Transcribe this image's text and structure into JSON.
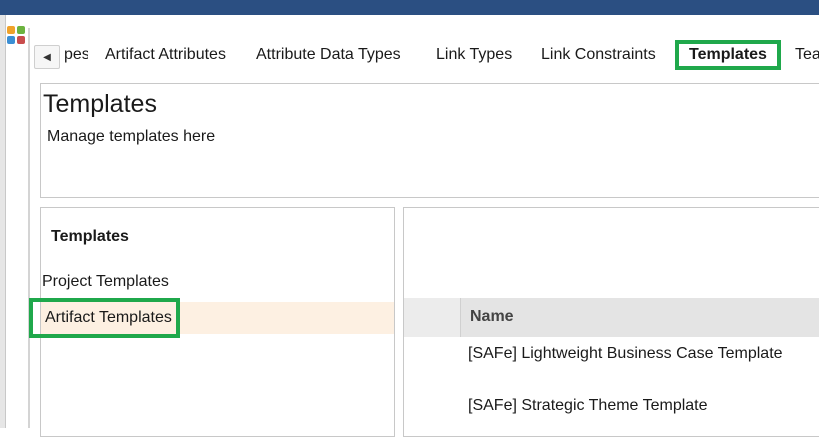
{
  "tabs": [
    {
      "label": "pes",
      "active": false
    },
    {
      "label": "Artifact Attributes",
      "active": false
    },
    {
      "label": "Attribute Data Types",
      "active": false
    },
    {
      "label": "Link Types",
      "active": false
    },
    {
      "label": "Link Constraints",
      "active": false
    },
    {
      "label": "Templates",
      "active": true
    },
    {
      "label": "Tea",
      "active": false
    }
  ],
  "header": {
    "title": "Templates",
    "subtitle": "Manage templates here"
  },
  "sidebar": {
    "heading": "Templates",
    "items": [
      {
        "label": "Project Templates",
        "selected": false
      },
      {
        "label": "Artifact Templates",
        "selected": true
      }
    ]
  },
  "grid": {
    "columns": [
      "Name"
    ],
    "rows": [
      {
        "name": "[SAFe] Lightweight Business Case Template"
      },
      {
        "name": "[SAFe] Strategic Theme Template"
      }
    ]
  },
  "colors": {
    "topbar": "#2b4f82",
    "highlight": "#1fa84b",
    "selection": "#fdf0e2"
  }
}
